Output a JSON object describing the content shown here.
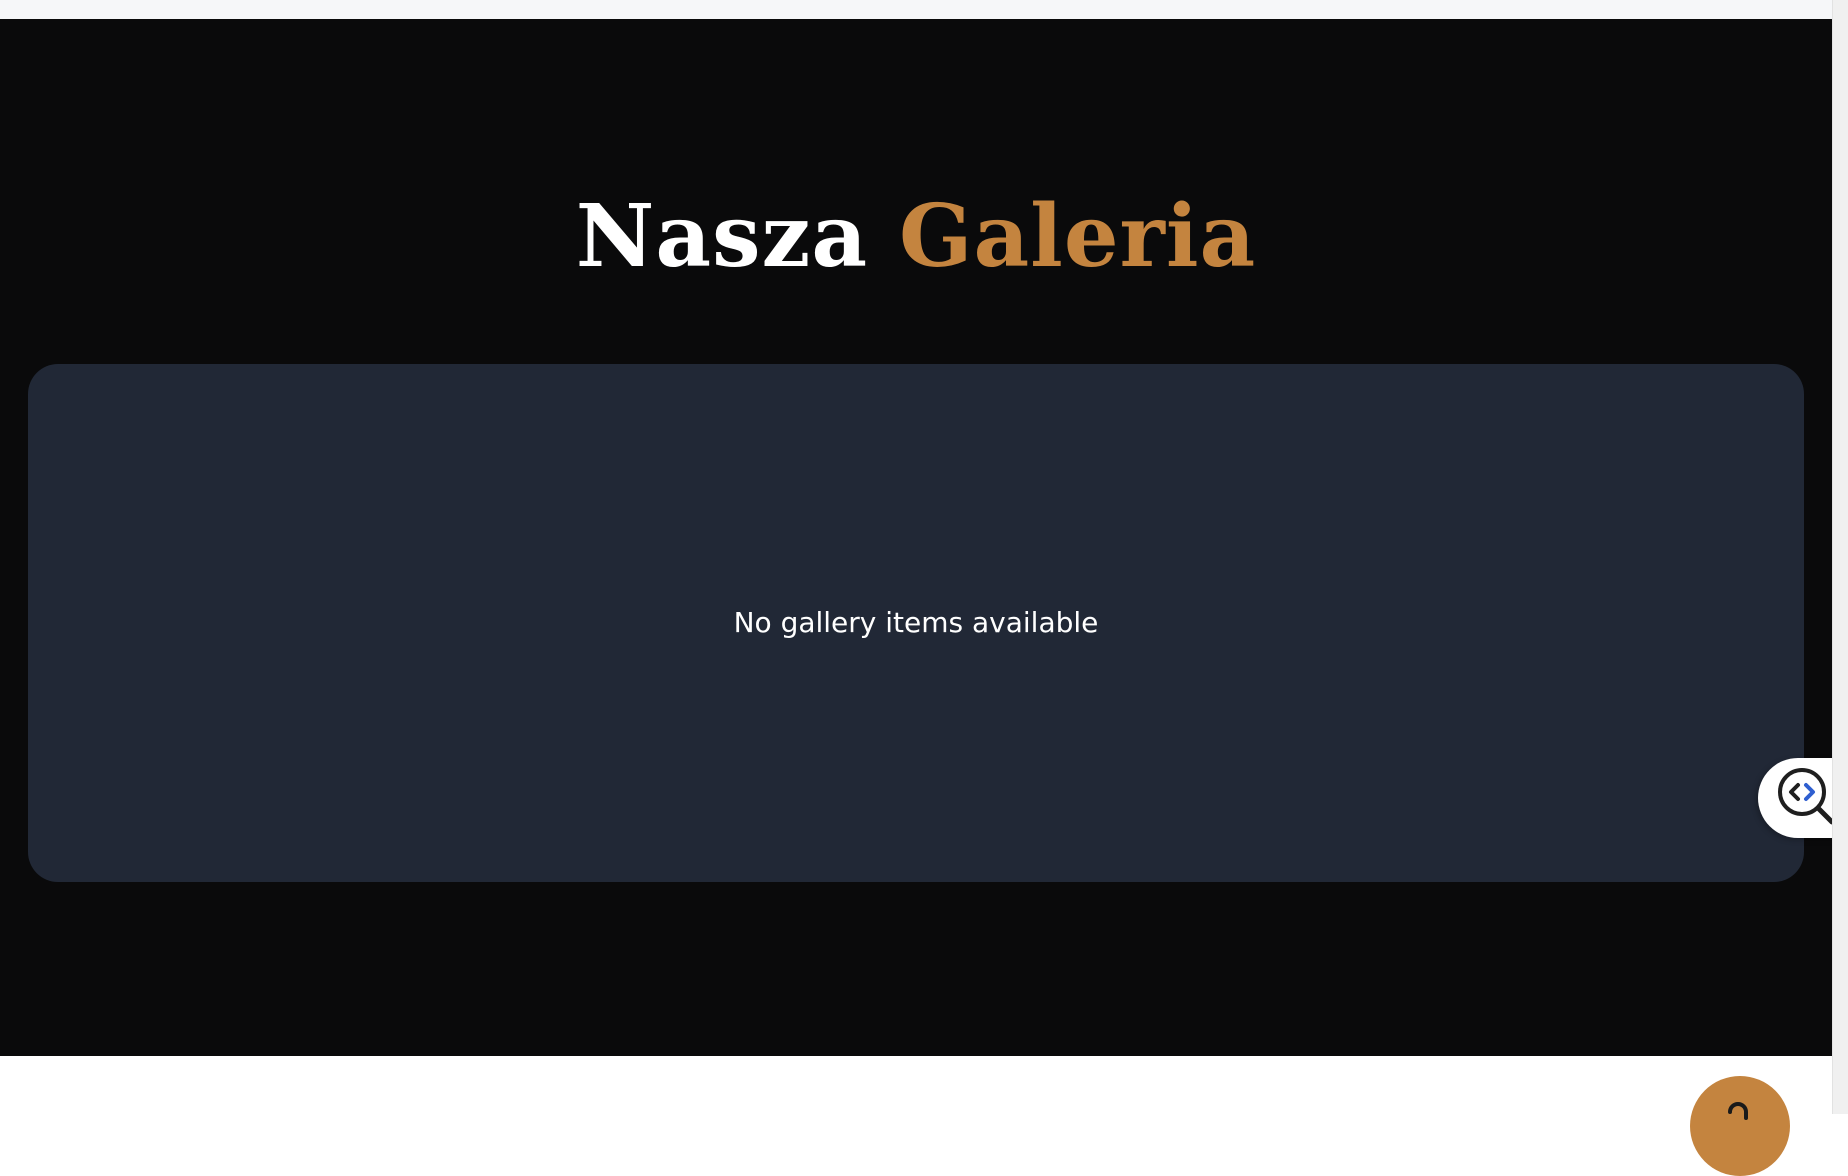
{
  "gallery": {
    "title_main": "Nasza",
    "title_accent": "Galeria",
    "empty_message": "No gallery items available"
  },
  "widgets": {
    "inspector_icon": "code-search-icon",
    "chat_icon": "chat-icon"
  },
  "colors": {
    "accent": "#c4843f",
    "section_bg": "#0a0a0b",
    "panel_bg": "#212836"
  }
}
